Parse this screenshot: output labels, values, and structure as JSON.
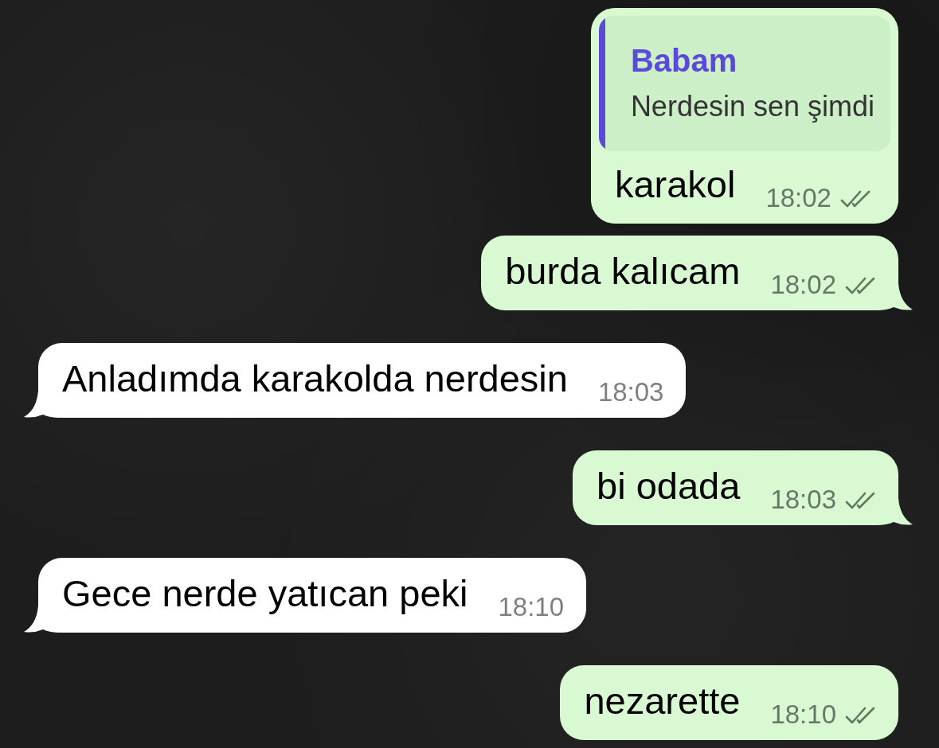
{
  "messages": [
    {
      "kind": "outgoing",
      "reply": {
        "author": "Babam",
        "text": "Nerdesin sen şimdi"
      },
      "text": "karakol",
      "time": "18:02",
      "read": false,
      "tail": false
    },
    {
      "kind": "outgoing",
      "text": "burda kalıcam",
      "time": "18:02",
      "read": false,
      "tail": true
    },
    {
      "kind": "incoming",
      "text": "Anladımda karakolda nerdesin",
      "time": "18:03",
      "tail": true
    },
    {
      "kind": "outgoing",
      "text": "bi odada",
      "time": "18:03",
      "read": false,
      "tail": true
    },
    {
      "kind": "incoming",
      "text": "Gece nerde yatıcan peki",
      "time": "18:10",
      "tail": true
    },
    {
      "kind": "outgoing",
      "text": "nezarette",
      "time": "18:10",
      "read": false,
      "tail": false
    }
  ]
}
